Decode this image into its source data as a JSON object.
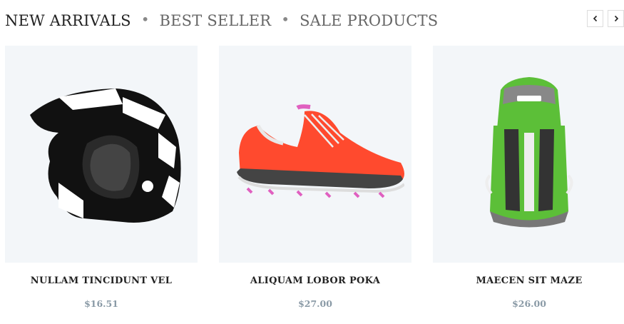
{
  "tabs": [
    {
      "label": "NEW ARRIVALS",
      "active": true
    },
    {
      "label": "BEST SELLER",
      "active": false
    },
    {
      "label": "SALE PRODUCTS",
      "active": false
    }
  ],
  "nav": {
    "prev_icon": "chevron-left-icon",
    "next_icon": "chevron-right-icon"
  },
  "products": [
    {
      "name": "NULLAM TINCIDUNT VEL",
      "price": "$16.51",
      "image": "motocross-helmet"
    },
    {
      "name": "ALIQUAM LOBOR POKA",
      "price": "$27.00",
      "image": "running-shoe"
    },
    {
      "name": "MAECEN SIT MAZE",
      "price": "$26.00",
      "image": "hiking-backpack"
    }
  ],
  "colors": {
    "image_bg": "#f3f6f9",
    "price": "#8a9aa6",
    "active_tab": "#222222",
    "inactive_tab": "#666666",
    "shoe": "#ff4a2e",
    "backpack": "#5cbf38"
  }
}
